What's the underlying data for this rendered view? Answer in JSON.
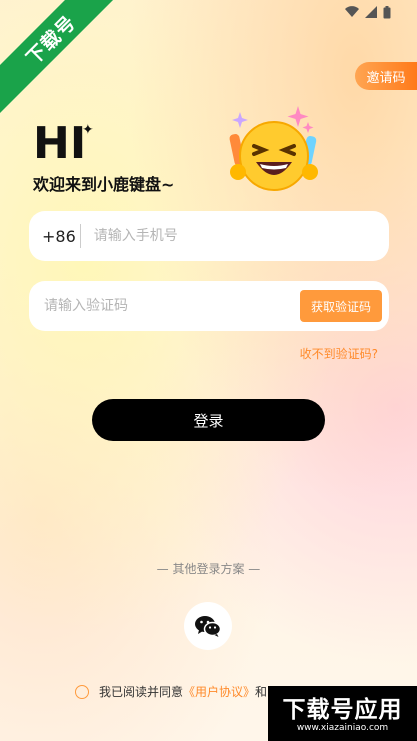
{
  "watermark": {
    "text": "下载号"
  },
  "invite": {
    "label": "邀请码"
  },
  "hero": {
    "hi": "HI",
    "welcome": "欢迎来到小鹿键盘~"
  },
  "phone": {
    "prefix": "+86",
    "placeholder": "请输入手机号",
    "value": ""
  },
  "code": {
    "placeholder": "请输入验证码",
    "value": "",
    "get_code_label": "获取验证码"
  },
  "no_code": {
    "label": "收不到验证码?"
  },
  "login": {
    "label": "登录"
  },
  "other_login": {
    "label": "— 其他登录方案 —"
  },
  "agreement": {
    "prefix": "我已阅读并同意",
    "user_agreement": "《用户协议》",
    "and": "和"
  },
  "badge": {
    "main": "下载号应用",
    "url": "www.xiazainiao.com"
  },
  "colors": {
    "accent": "#ff9a3c",
    "login_button": "#000000",
    "watermark_green": "#1aa34a"
  },
  "icons": [
    "wifi-icon",
    "signal-icon",
    "battery-icon",
    "laughing-emoji-icon",
    "sparkle-icon",
    "wechat-icon"
  ]
}
